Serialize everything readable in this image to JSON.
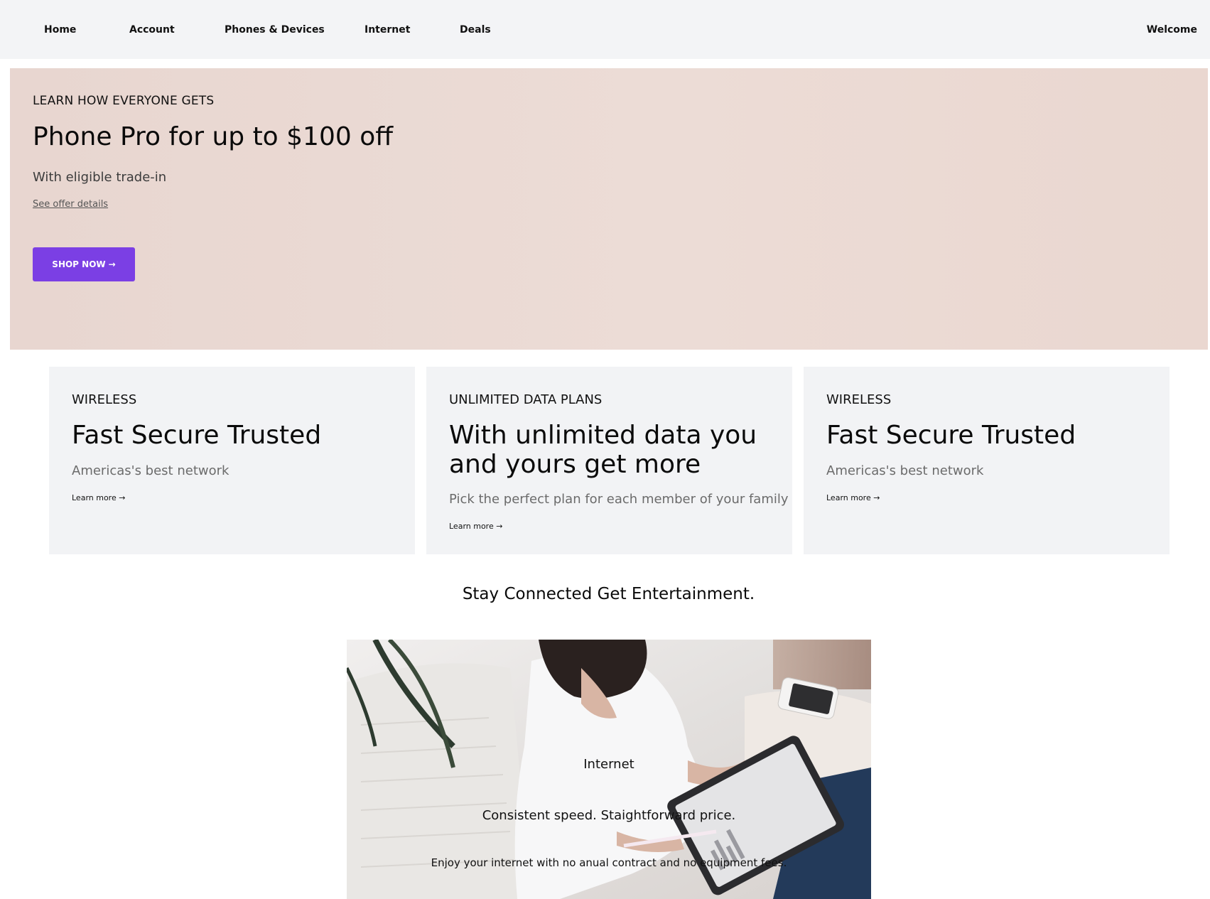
{
  "nav": {
    "items": [
      "Home",
      "Account",
      "Phones & Devices",
      "Internet",
      "Deals"
    ],
    "welcome": "Welcome"
  },
  "hero": {
    "eyebrow": "LEARN HOW EVERYONE GETS",
    "title": "Phone Pro for up to $100 off",
    "subtitle": "With eligible trade-in",
    "offer_link": "See offer details",
    "button_label": "SHOP NOW",
    "button_arrow": "→",
    "background_color": "#e9d8d1",
    "button_color": "#7b3fe4"
  },
  "cards": [
    {
      "eyebrow": "WIRELESS",
      "title": "Fast Secure Trusted",
      "description": "Americas's best network",
      "link": "Learn more →"
    },
    {
      "eyebrow": "UNLIMITED DATA PLANS",
      "title": "With unlimited data you and yours get more",
      "description": "Pick the perfect plan for each member of your family",
      "link": "Learn more →"
    },
    {
      "eyebrow": "WIRELESS",
      "title": "Fast Secure Trusted",
      "description": "Americas's best network",
      "link": "Learn more →"
    }
  ],
  "section": {
    "title": "Stay Connected Get Entertainment."
  },
  "feature": {
    "label": "Internet",
    "headline": "Consistent speed. Staightforward price.",
    "body": "Enjoy your internet with no anual contract and no equipment fees."
  }
}
